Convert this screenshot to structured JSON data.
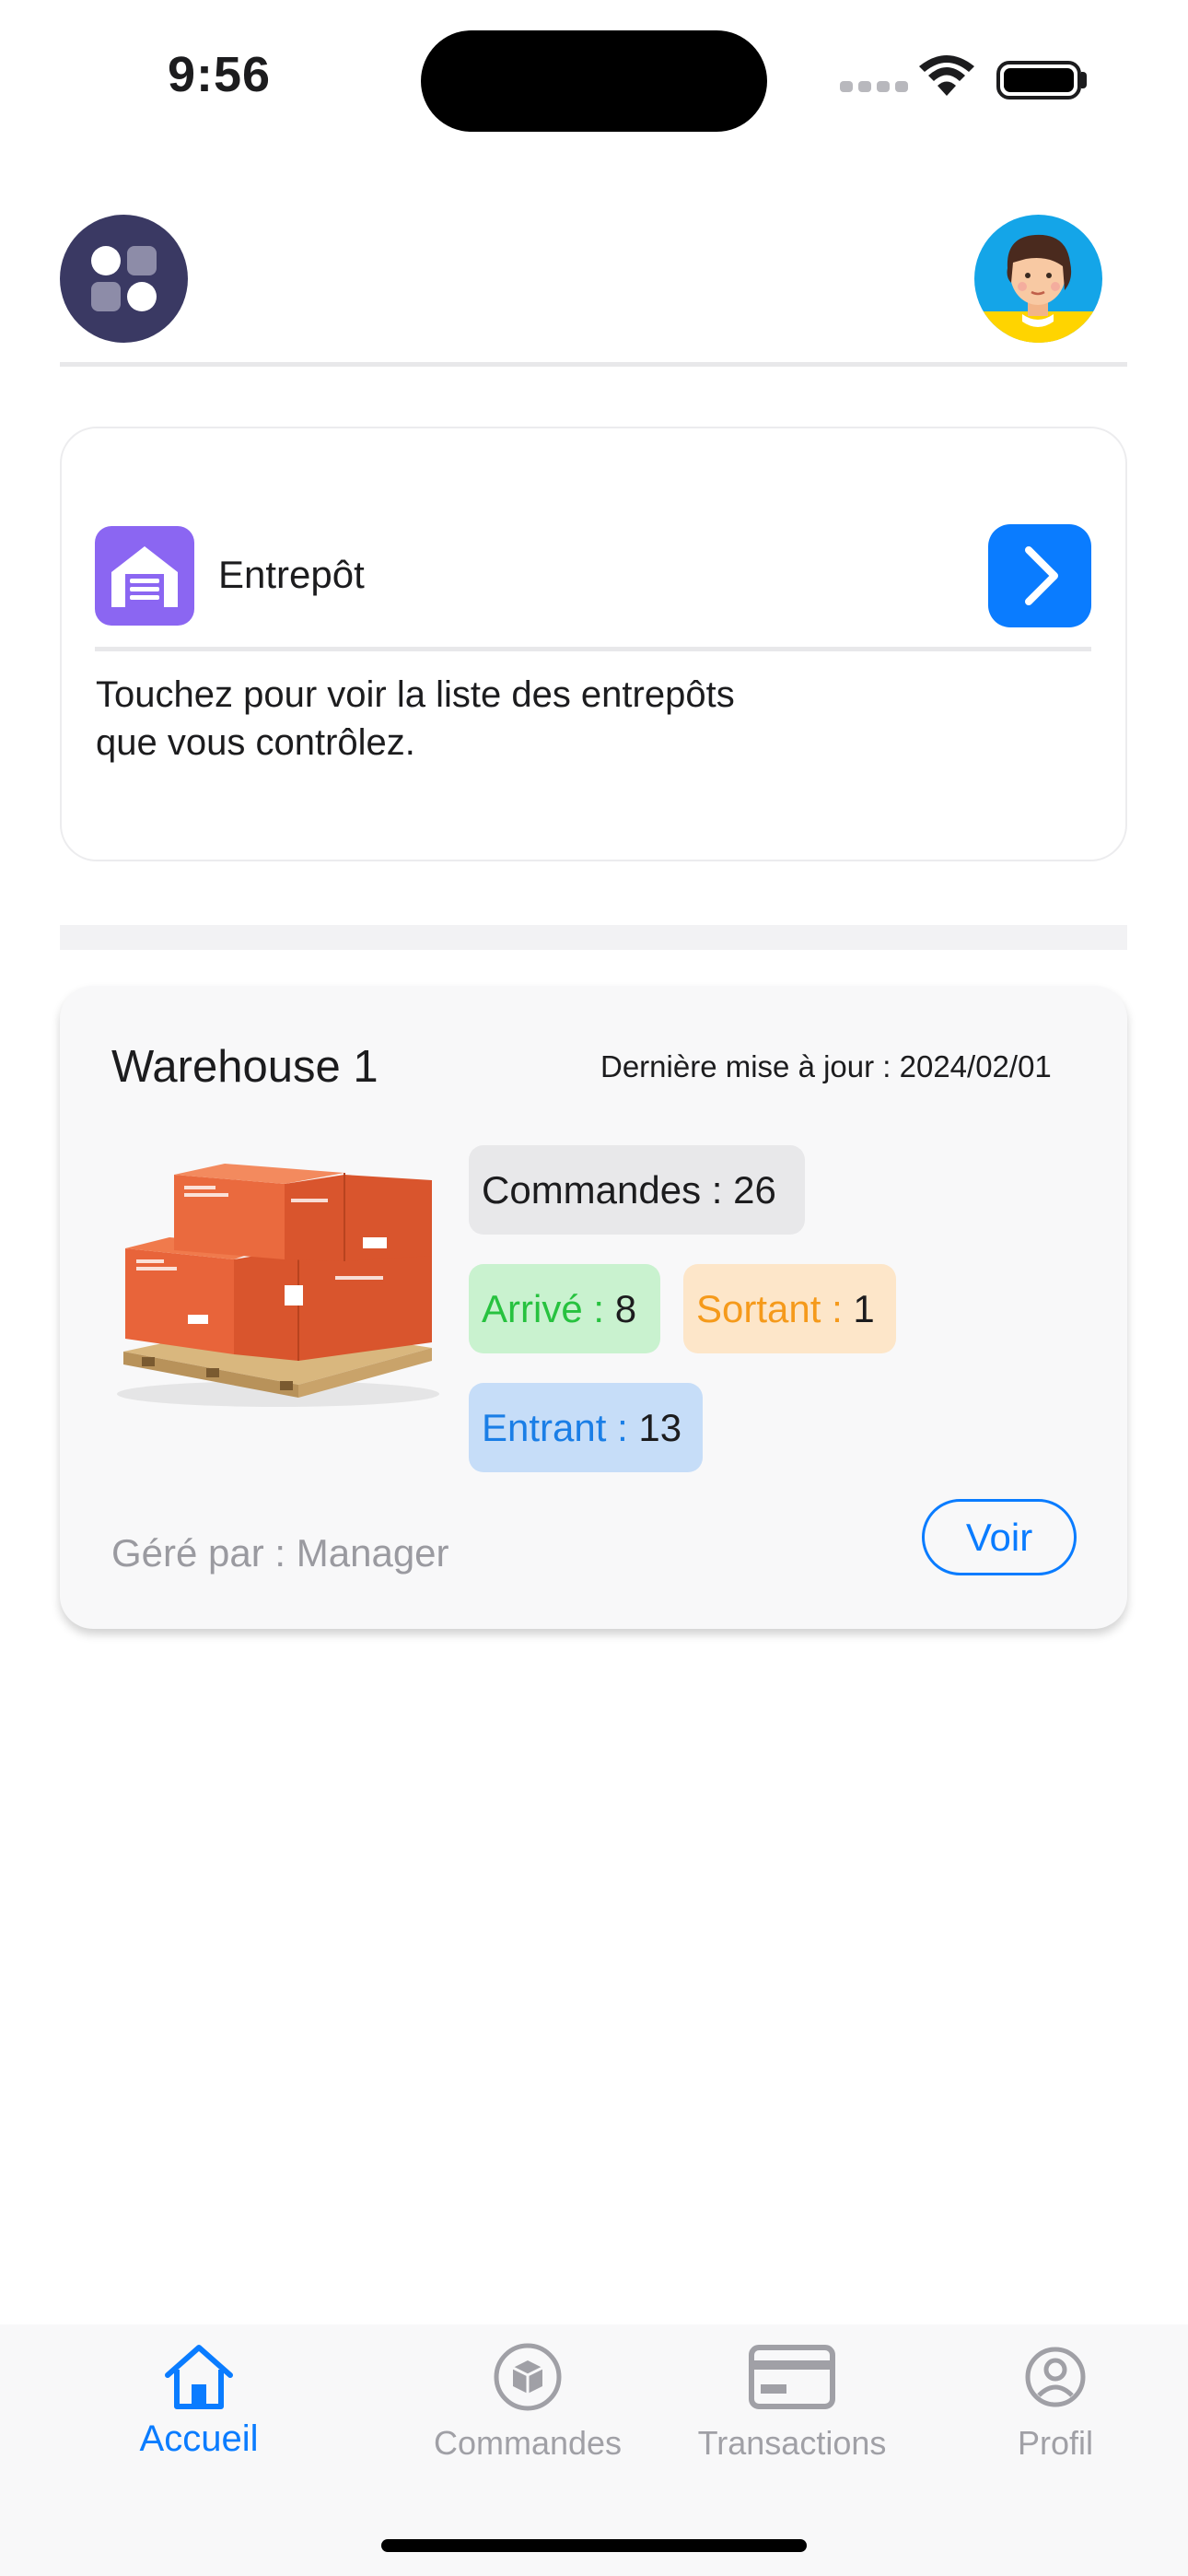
{
  "status_bar": {
    "time": "9:56"
  },
  "warehouse_entry": {
    "title": "Entrepôt",
    "description_lines": [
      "Touchez pour voir la liste des entrepôts",
      "que vous contrôlez."
    ]
  },
  "warehouse_card": {
    "name": "Warehouse 1",
    "last_update": "Dernière mise à jour : 2024/02/01",
    "orders_label": "Commandes : ",
    "orders_value": "26",
    "arrived_label": "Arrivé : ",
    "arrived_value": "8",
    "outgoing_label": "Sortant : ",
    "outgoing_value": "1",
    "incoming_label": "Entrant : ",
    "incoming_value": "13",
    "managed_by": "Géré par : Manager",
    "view_button": "Voir"
  },
  "tabs": [
    {
      "label": "Accueil",
      "icon": "home-icon",
      "active": true
    },
    {
      "label": "Commandes",
      "icon": "box-icon",
      "active": false
    },
    {
      "label": "Transactions",
      "icon": "card-icon",
      "active": false
    },
    {
      "label": "Profil",
      "icon": "user-circle-icon",
      "active": false
    }
  ],
  "colors": {
    "accent": "#0a7cff",
    "menu_button": "#3a3963",
    "warehouse_icon": "#8b66f2",
    "arrived_text": "#27c23f",
    "outgoing_text": "#f59a1b",
    "incoming_text": "#1a7ee6",
    "inactive_tab": "#a0a0a6"
  }
}
